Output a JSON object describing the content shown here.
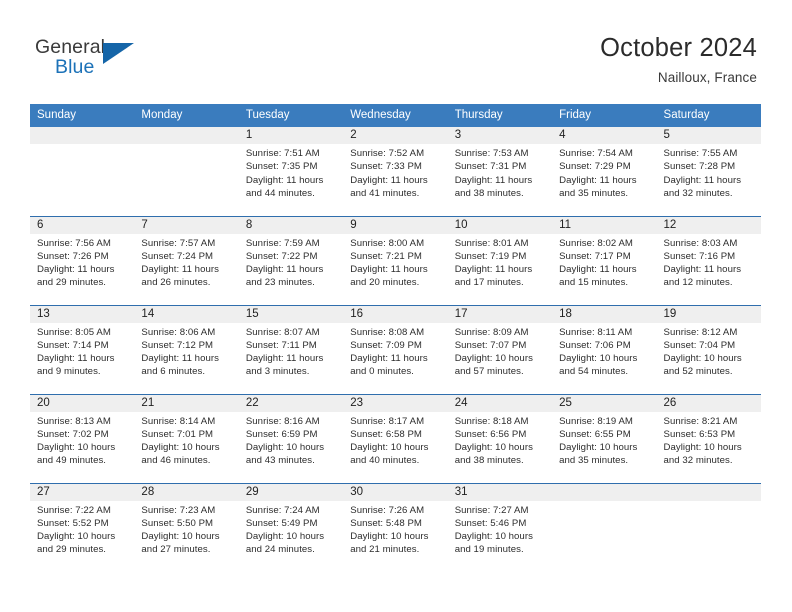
{
  "brand": {
    "name_part1": "General",
    "name_part2": "Blue",
    "accent_color": "#1565a8"
  },
  "header": {
    "title": "October 2024",
    "location": "Nailloux, France"
  },
  "calendar": {
    "header_bg": "#3a7cbe",
    "row_rule_color": "#2f6ead",
    "daynum_band_bg": "#efefef",
    "weekday_headers": [
      "Sunday",
      "Monday",
      "Tuesday",
      "Wednesday",
      "Thursday",
      "Friday",
      "Saturday"
    ],
    "weeks": [
      [
        {
          "day": "",
          "lines": []
        },
        {
          "day": "",
          "lines": []
        },
        {
          "day": "1",
          "lines": [
            "Sunrise: 7:51 AM",
            "Sunset: 7:35 PM",
            "Daylight: 11 hours",
            "and 44 minutes."
          ]
        },
        {
          "day": "2",
          "lines": [
            "Sunrise: 7:52 AM",
            "Sunset: 7:33 PM",
            "Daylight: 11 hours",
            "and 41 minutes."
          ]
        },
        {
          "day": "3",
          "lines": [
            "Sunrise: 7:53 AM",
            "Sunset: 7:31 PM",
            "Daylight: 11 hours",
            "and 38 minutes."
          ]
        },
        {
          "day": "4",
          "lines": [
            "Sunrise: 7:54 AM",
            "Sunset: 7:29 PM",
            "Daylight: 11 hours",
            "and 35 minutes."
          ]
        },
        {
          "day": "5",
          "lines": [
            "Sunrise: 7:55 AM",
            "Sunset: 7:28 PM",
            "Daylight: 11 hours",
            "and 32 minutes."
          ]
        }
      ],
      [
        {
          "day": "6",
          "lines": [
            "Sunrise: 7:56 AM",
            "Sunset: 7:26 PM",
            "Daylight: 11 hours",
            "and 29 minutes."
          ]
        },
        {
          "day": "7",
          "lines": [
            "Sunrise: 7:57 AM",
            "Sunset: 7:24 PM",
            "Daylight: 11 hours",
            "and 26 minutes."
          ]
        },
        {
          "day": "8",
          "lines": [
            "Sunrise: 7:59 AM",
            "Sunset: 7:22 PM",
            "Daylight: 11 hours",
            "and 23 minutes."
          ]
        },
        {
          "day": "9",
          "lines": [
            "Sunrise: 8:00 AM",
            "Sunset: 7:21 PM",
            "Daylight: 11 hours",
            "and 20 minutes."
          ]
        },
        {
          "day": "10",
          "lines": [
            "Sunrise: 8:01 AM",
            "Sunset: 7:19 PM",
            "Daylight: 11 hours",
            "and 17 minutes."
          ]
        },
        {
          "day": "11",
          "lines": [
            "Sunrise: 8:02 AM",
            "Sunset: 7:17 PM",
            "Daylight: 11 hours",
            "and 15 minutes."
          ]
        },
        {
          "day": "12",
          "lines": [
            "Sunrise: 8:03 AM",
            "Sunset: 7:16 PM",
            "Daylight: 11 hours",
            "and 12 minutes."
          ]
        }
      ],
      [
        {
          "day": "13",
          "lines": [
            "Sunrise: 8:05 AM",
            "Sunset: 7:14 PM",
            "Daylight: 11 hours",
            "and 9 minutes."
          ]
        },
        {
          "day": "14",
          "lines": [
            "Sunrise: 8:06 AM",
            "Sunset: 7:12 PM",
            "Daylight: 11 hours",
            "and 6 minutes."
          ]
        },
        {
          "day": "15",
          "lines": [
            "Sunrise: 8:07 AM",
            "Sunset: 7:11 PM",
            "Daylight: 11 hours",
            "and 3 minutes."
          ]
        },
        {
          "day": "16",
          "lines": [
            "Sunrise: 8:08 AM",
            "Sunset: 7:09 PM",
            "Daylight: 11 hours",
            "and 0 minutes."
          ]
        },
        {
          "day": "17",
          "lines": [
            "Sunrise: 8:09 AM",
            "Sunset: 7:07 PM",
            "Daylight: 10 hours",
            "and 57 minutes."
          ]
        },
        {
          "day": "18",
          "lines": [
            "Sunrise: 8:11 AM",
            "Sunset: 7:06 PM",
            "Daylight: 10 hours",
            "and 54 minutes."
          ]
        },
        {
          "day": "19",
          "lines": [
            "Sunrise: 8:12 AM",
            "Sunset: 7:04 PM",
            "Daylight: 10 hours",
            "and 52 minutes."
          ]
        }
      ],
      [
        {
          "day": "20",
          "lines": [
            "Sunrise: 8:13 AM",
            "Sunset: 7:02 PM",
            "Daylight: 10 hours",
            "and 49 minutes."
          ]
        },
        {
          "day": "21",
          "lines": [
            "Sunrise: 8:14 AM",
            "Sunset: 7:01 PM",
            "Daylight: 10 hours",
            "and 46 minutes."
          ]
        },
        {
          "day": "22",
          "lines": [
            "Sunrise: 8:16 AM",
            "Sunset: 6:59 PM",
            "Daylight: 10 hours",
            "and 43 minutes."
          ]
        },
        {
          "day": "23",
          "lines": [
            "Sunrise: 8:17 AM",
            "Sunset: 6:58 PM",
            "Daylight: 10 hours",
            "and 40 minutes."
          ]
        },
        {
          "day": "24",
          "lines": [
            "Sunrise: 8:18 AM",
            "Sunset: 6:56 PM",
            "Daylight: 10 hours",
            "and 38 minutes."
          ]
        },
        {
          "day": "25",
          "lines": [
            "Sunrise: 8:19 AM",
            "Sunset: 6:55 PM",
            "Daylight: 10 hours",
            "and 35 minutes."
          ]
        },
        {
          "day": "26",
          "lines": [
            "Sunrise: 8:21 AM",
            "Sunset: 6:53 PM",
            "Daylight: 10 hours",
            "and 32 minutes."
          ]
        }
      ],
      [
        {
          "day": "27",
          "lines": [
            "Sunrise: 7:22 AM",
            "Sunset: 5:52 PM",
            "Daylight: 10 hours",
            "and 29 minutes."
          ]
        },
        {
          "day": "28",
          "lines": [
            "Sunrise: 7:23 AM",
            "Sunset: 5:50 PM",
            "Daylight: 10 hours",
            "and 27 minutes."
          ]
        },
        {
          "day": "29",
          "lines": [
            "Sunrise: 7:24 AM",
            "Sunset: 5:49 PM",
            "Daylight: 10 hours",
            "and 24 minutes."
          ]
        },
        {
          "day": "30",
          "lines": [
            "Sunrise: 7:26 AM",
            "Sunset: 5:48 PM",
            "Daylight: 10 hours",
            "and 21 minutes."
          ]
        },
        {
          "day": "31",
          "lines": [
            "Sunrise: 7:27 AM",
            "Sunset: 5:46 PM",
            "Daylight: 10 hours",
            "and 19 minutes."
          ]
        },
        {
          "day": "",
          "lines": []
        },
        {
          "day": "",
          "lines": []
        }
      ]
    ]
  }
}
